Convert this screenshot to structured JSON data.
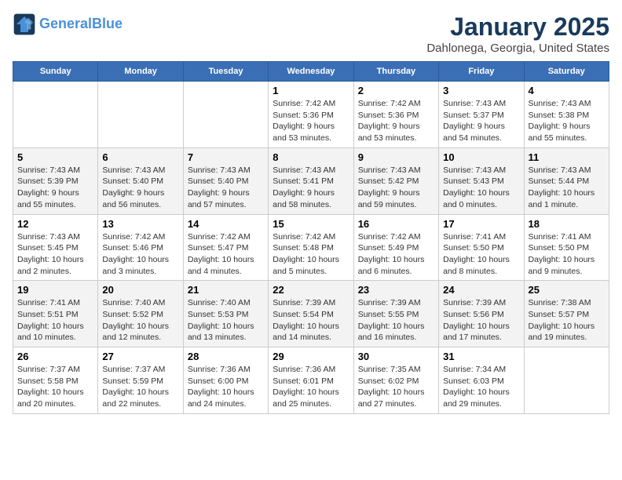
{
  "logo": {
    "line1": "General",
    "line2": "Blue"
  },
  "title": "January 2025",
  "subtitle": "Dahlonega, Georgia, United States",
  "headers": [
    "Sunday",
    "Monday",
    "Tuesday",
    "Wednesday",
    "Thursday",
    "Friday",
    "Saturday"
  ],
  "weeks": [
    [
      {
        "num": "",
        "text": ""
      },
      {
        "num": "",
        "text": ""
      },
      {
        "num": "",
        "text": ""
      },
      {
        "num": "1",
        "text": "Sunrise: 7:42 AM\nSunset: 5:36 PM\nDaylight: 9 hours and 53 minutes."
      },
      {
        "num": "2",
        "text": "Sunrise: 7:42 AM\nSunset: 5:36 PM\nDaylight: 9 hours and 53 minutes."
      },
      {
        "num": "3",
        "text": "Sunrise: 7:43 AM\nSunset: 5:37 PM\nDaylight: 9 hours and 54 minutes."
      },
      {
        "num": "4",
        "text": "Sunrise: 7:43 AM\nSunset: 5:38 PM\nDaylight: 9 hours and 55 minutes."
      }
    ],
    [
      {
        "num": "5",
        "text": "Sunrise: 7:43 AM\nSunset: 5:39 PM\nDaylight: 9 hours and 55 minutes."
      },
      {
        "num": "6",
        "text": "Sunrise: 7:43 AM\nSunset: 5:40 PM\nDaylight: 9 hours and 56 minutes."
      },
      {
        "num": "7",
        "text": "Sunrise: 7:43 AM\nSunset: 5:40 PM\nDaylight: 9 hours and 57 minutes."
      },
      {
        "num": "8",
        "text": "Sunrise: 7:43 AM\nSunset: 5:41 PM\nDaylight: 9 hours and 58 minutes."
      },
      {
        "num": "9",
        "text": "Sunrise: 7:43 AM\nSunset: 5:42 PM\nDaylight: 9 hours and 59 minutes."
      },
      {
        "num": "10",
        "text": "Sunrise: 7:43 AM\nSunset: 5:43 PM\nDaylight: 10 hours and 0 minutes."
      },
      {
        "num": "11",
        "text": "Sunrise: 7:43 AM\nSunset: 5:44 PM\nDaylight: 10 hours and 1 minute."
      }
    ],
    [
      {
        "num": "12",
        "text": "Sunrise: 7:43 AM\nSunset: 5:45 PM\nDaylight: 10 hours and 2 minutes."
      },
      {
        "num": "13",
        "text": "Sunrise: 7:42 AM\nSunset: 5:46 PM\nDaylight: 10 hours and 3 minutes."
      },
      {
        "num": "14",
        "text": "Sunrise: 7:42 AM\nSunset: 5:47 PM\nDaylight: 10 hours and 4 minutes."
      },
      {
        "num": "15",
        "text": "Sunrise: 7:42 AM\nSunset: 5:48 PM\nDaylight: 10 hours and 5 minutes."
      },
      {
        "num": "16",
        "text": "Sunrise: 7:42 AM\nSunset: 5:49 PM\nDaylight: 10 hours and 6 minutes."
      },
      {
        "num": "17",
        "text": "Sunrise: 7:41 AM\nSunset: 5:50 PM\nDaylight: 10 hours and 8 minutes."
      },
      {
        "num": "18",
        "text": "Sunrise: 7:41 AM\nSunset: 5:50 PM\nDaylight: 10 hours and 9 minutes."
      }
    ],
    [
      {
        "num": "19",
        "text": "Sunrise: 7:41 AM\nSunset: 5:51 PM\nDaylight: 10 hours and 10 minutes."
      },
      {
        "num": "20",
        "text": "Sunrise: 7:40 AM\nSunset: 5:52 PM\nDaylight: 10 hours and 12 minutes."
      },
      {
        "num": "21",
        "text": "Sunrise: 7:40 AM\nSunset: 5:53 PM\nDaylight: 10 hours and 13 minutes."
      },
      {
        "num": "22",
        "text": "Sunrise: 7:39 AM\nSunset: 5:54 PM\nDaylight: 10 hours and 14 minutes."
      },
      {
        "num": "23",
        "text": "Sunrise: 7:39 AM\nSunset: 5:55 PM\nDaylight: 10 hours and 16 minutes."
      },
      {
        "num": "24",
        "text": "Sunrise: 7:39 AM\nSunset: 5:56 PM\nDaylight: 10 hours and 17 minutes."
      },
      {
        "num": "25",
        "text": "Sunrise: 7:38 AM\nSunset: 5:57 PM\nDaylight: 10 hours and 19 minutes."
      }
    ],
    [
      {
        "num": "26",
        "text": "Sunrise: 7:37 AM\nSunset: 5:58 PM\nDaylight: 10 hours and 20 minutes."
      },
      {
        "num": "27",
        "text": "Sunrise: 7:37 AM\nSunset: 5:59 PM\nDaylight: 10 hours and 22 minutes."
      },
      {
        "num": "28",
        "text": "Sunrise: 7:36 AM\nSunset: 6:00 PM\nDaylight: 10 hours and 24 minutes."
      },
      {
        "num": "29",
        "text": "Sunrise: 7:36 AM\nSunset: 6:01 PM\nDaylight: 10 hours and 25 minutes."
      },
      {
        "num": "30",
        "text": "Sunrise: 7:35 AM\nSunset: 6:02 PM\nDaylight: 10 hours and 27 minutes."
      },
      {
        "num": "31",
        "text": "Sunrise: 7:34 AM\nSunset: 6:03 PM\nDaylight: 10 hours and 29 minutes."
      },
      {
        "num": "",
        "text": ""
      }
    ]
  ]
}
